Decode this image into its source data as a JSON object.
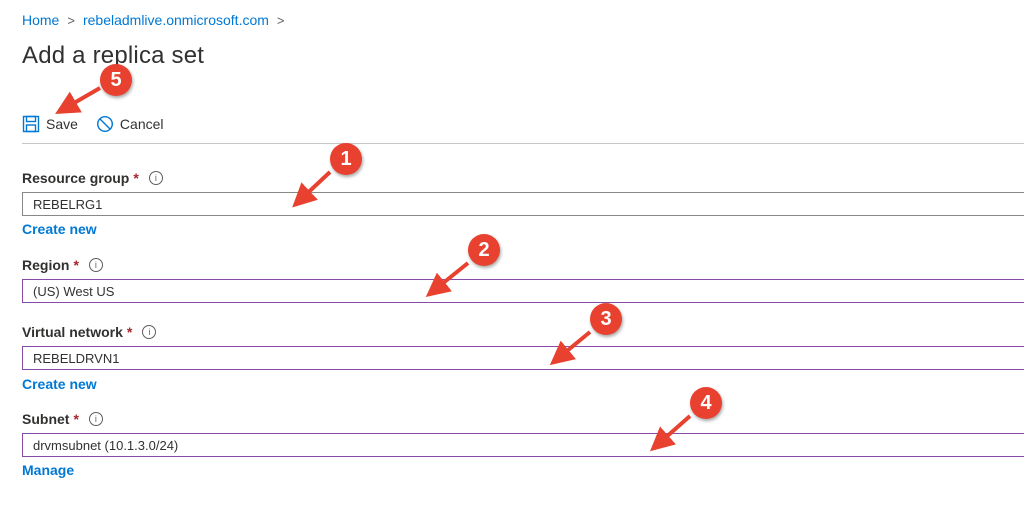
{
  "breadcrumb": {
    "home": "Home",
    "tenant": "rebeladmlive.onmicrosoft.com",
    "separator": ">"
  },
  "page_title": "Add a replica set",
  "toolbar": {
    "save_label": "Save",
    "cancel_label": "Cancel"
  },
  "form": {
    "resource_group": {
      "label": "Resource group",
      "required": "*",
      "value": "REBELRG1",
      "link": "Create new"
    },
    "region": {
      "label": "Region",
      "required": "*",
      "value": "(US) West US"
    },
    "virtual_network": {
      "label": "Virtual network",
      "required": "*",
      "value": "REBELDRVN1",
      "link": "Create new"
    },
    "subnet": {
      "label": "Subnet",
      "required": "*",
      "value": "drvmsubnet (10.1.3.0/24)",
      "link": "Manage"
    }
  },
  "info_glyph": "i",
  "annotations": [
    "1",
    "2",
    "3",
    "4",
    "5"
  ],
  "colors": {
    "accent": "#0078d4",
    "badge": "#e8412f",
    "required": "#a4262c",
    "select_border": "#8a4aa8"
  },
  "icons": {
    "save": "save-icon",
    "cancel": "cancel-icon",
    "info": "info-icon"
  }
}
